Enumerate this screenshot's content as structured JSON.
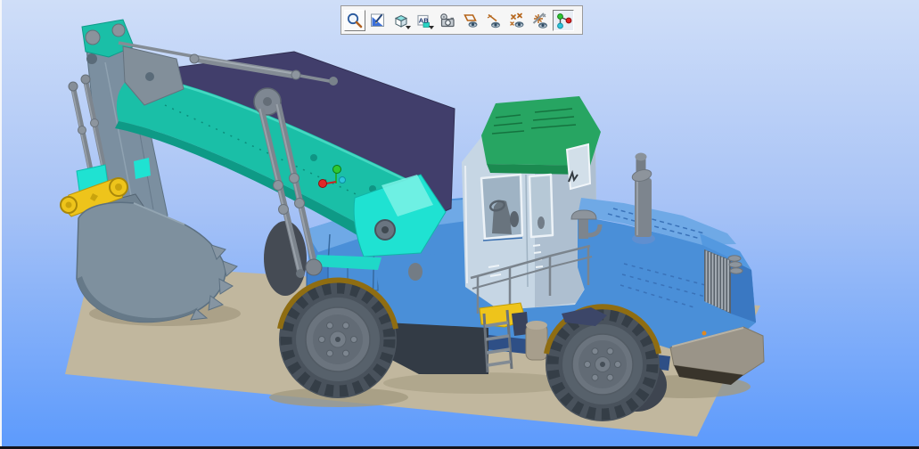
{
  "toolbar": {
    "buttons": [
      {
        "name": "zoom-area",
        "raised": true
      },
      {
        "name": "view-orientation"
      },
      {
        "name": "display-mode"
      },
      {
        "name": "designation-visibility",
        "glyph": "AB"
      },
      {
        "name": "save-image"
      },
      {
        "name": "hide-planes"
      },
      {
        "name": "hide-axes"
      },
      {
        "name": "hide-points"
      },
      {
        "name": "hide-all-auxiliary"
      },
      {
        "name": "component-structure",
        "pressed": true
      }
    ]
  },
  "scene": {
    "model": "wheeled-excavator-3d-model",
    "ground": "tan-work-plane",
    "origin_marker": {
      "up_axis": "#2fc832",
      "left_axis": "#e02828",
      "front_axis": "#2cc4dc"
    }
  },
  "colors": {
    "bg-top": "#cfdef8",
    "bg-mid": "#a8c3f6",
    "bg-bottom": "#5c9afc",
    "toolbar-bg": "#f6f6f6",
    "toolbar-border": "#9a9a9a",
    "ground": "#c1b79e",
    "ground-shadow": "#a39a80",
    "boom-teal": "#1abfa7",
    "boom-teal-dark": "#0e9a86",
    "boom-navy": "#413e6b",
    "accent-cyan": "#1fe2d2",
    "arm-gray": "#7b8fa0",
    "bucket-gray": "#7e909e",
    "link-yellow": "#eec41b",
    "metal-gray": "#7d858e",
    "body-blue": "#4a8fd8",
    "body-blue-light": "#6fa9e6",
    "body-blue-dark": "#3a78c2",
    "cab-light": "#c6d6e4",
    "cab-side": "#aebfd0",
    "roof-green": "#27a562",
    "roof-green-dark": "#1b8a50",
    "window-glass": "#9fb3c4",
    "tire-dark": "#49525c",
    "tire-tread": "#353e47",
    "hub-gray": "#6b747e",
    "rim-olive": "#8f6d12",
    "under-dark": "#333b45",
    "icon-orange": "#b5651a"
  }
}
